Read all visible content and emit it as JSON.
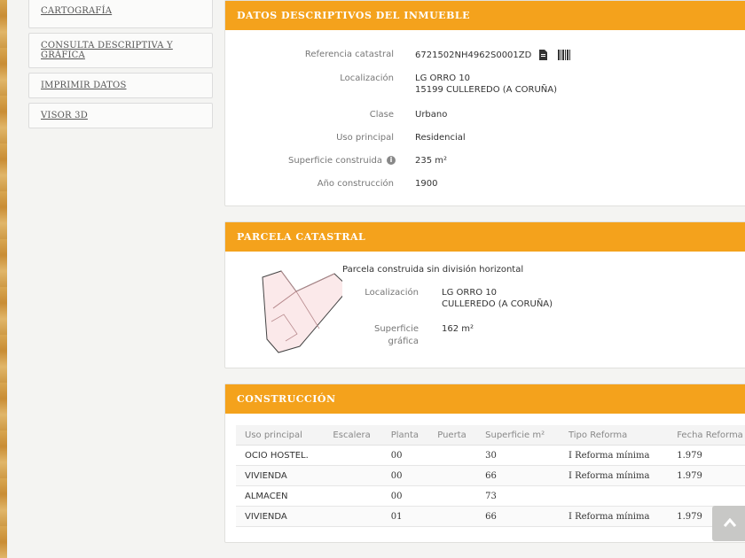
{
  "sidebar": {
    "items": [
      {
        "label": "CARTOGRAFÍA"
      },
      {
        "label": "CONSULTA DESCRIPTIVA Y GRÁFICA"
      },
      {
        "label": "IMPRIMIR DATOS"
      },
      {
        "label": "VISOR 3D"
      }
    ]
  },
  "descriptivos": {
    "title": "DATOS DESCRIPTIVOS DEL INMUEBLE",
    "rows": [
      {
        "label": "Referencia catastral",
        "value": "6721502NH4962S0001ZD"
      },
      {
        "label": "Localización",
        "value": "LG ORRO 10",
        "value2": "15199 CULLEREDO (A CORUÑA)"
      },
      {
        "label": "Clase",
        "value": "Urbano"
      },
      {
        "label": "Uso principal",
        "value": "Residencial"
      },
      {
        "label": "Superficie construida",
        "value": "235 m²"
      },
      {
        "label": "Año construcción",
        "value": "1900"
      }
    ]
  },
  "parcela": {
    "title": "PARCELA CATASTRAL",
    "subtitle": "Parcela construida sin división horizontal",
    "loc_label": "Localización",
    "loc_value1": "LG ORRO 10",
    "loc_value2": "CULLEREDO (A CORUÑA)",
    "sup_label1": "Superficie",
    "sup_label2": "gráfica",
    "sup_value": "162 m²"
  },
  "construccion": {
    "title": "CONSTRUCCIÓN",
    "headers": [
      "Uso principal",
      "Escalera",
      "Planta",
      "Puerta",
      "Superficie m²",
      "Tipo Reforma",
      "Fecha Reforma"
    ],
    "rows": [
      [
        "OCIO HOSTEL.",
        "",
        "00",
        "",
        "30",
        "I Reforma mínima",
        "1.979"
      ],
      [
        "VIVIENDA",
        "",
        "00",
        "",
        "66",
        "I Reforma mínima",
        "1.979"
      ],
      [
        "ALMACEN",
        "",
        "00",
        "",
        "73",
        "",
        ""
      ],
      [
        "VIVIENDA",
        "",
        "01",
        "",
        "66",
        "I Reforma mínima",
        "1.979"
      ]
    ]
  },
  "colors": {
    "header": "#f4a21c",
    "panel": "#ffffff",
    "page": "#f4f4f2"
  },
  "icons": [
    "document-icon",
    "barcode-icon",
    "info-icon",
    "chevron-up-icon"
  ]
}
